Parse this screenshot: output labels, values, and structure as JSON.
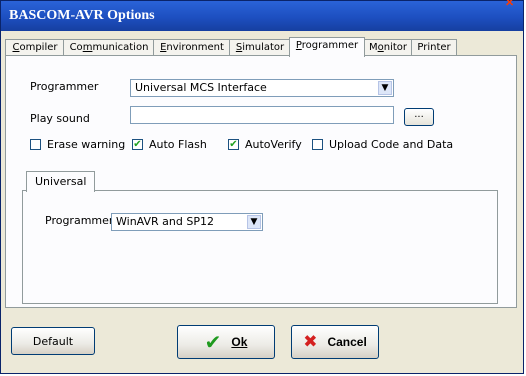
{
  "window": {
    "title": "BASCOM-AVR Options"
  },
  "tabs": [
    {
      "label": "Compiler",
      "ul": "C",
      "rest": "ompiler"
    },
    {
      "label": "Communication",
      "pre": "Co",
      "ul": "m",
      "rest": "munication"
    },
    {
      "label": "Environment",
      "ul": "E",
      "rest": "nvironment"
    },
    {
      "label": "Simulator",
      "ul": "S",
      "rest": "imulator"
    },
    {
      "label": "Programmer",
      "ul": "P",
      "rest": "rogrammer"
    },
    {
      "label": "Monitor",
      "pre": "M",
      "ul": "o",
      "rest": "nitor"
    },
    {
      "label": "Printer",
      "ul": "",
      "rest": "Printer"
    }
  ],
  "programmer_tab": {
    "programmer_label": "Programmer",
    "programmer_value": "Universal MCS Interface",
    "play_sound_label": "Play sound",
    "play_sound_value": "",
    "browse_label": "...",
    "checkboxes": [
      {
        "label": "Erase warning",
        "checked": false
      },
      {
        "label": "Auto Flash",
        "checked": true
      },
      {
        "label": "AutoVerify",
        "checked": true
      },
      {
        "label": "Upload Code and Data",
        "checked": false
      }
    ],
    "subtab_label": "Universal",
    "sub_programmer_label": "Programmer",
    "sub_programmer_value": "WinAVR and SP12"
  },
  "footer": {
    "default_label": "Default",
    "ok_label": "Ok",
    "cancel_label": "Cancel"
  }
}
